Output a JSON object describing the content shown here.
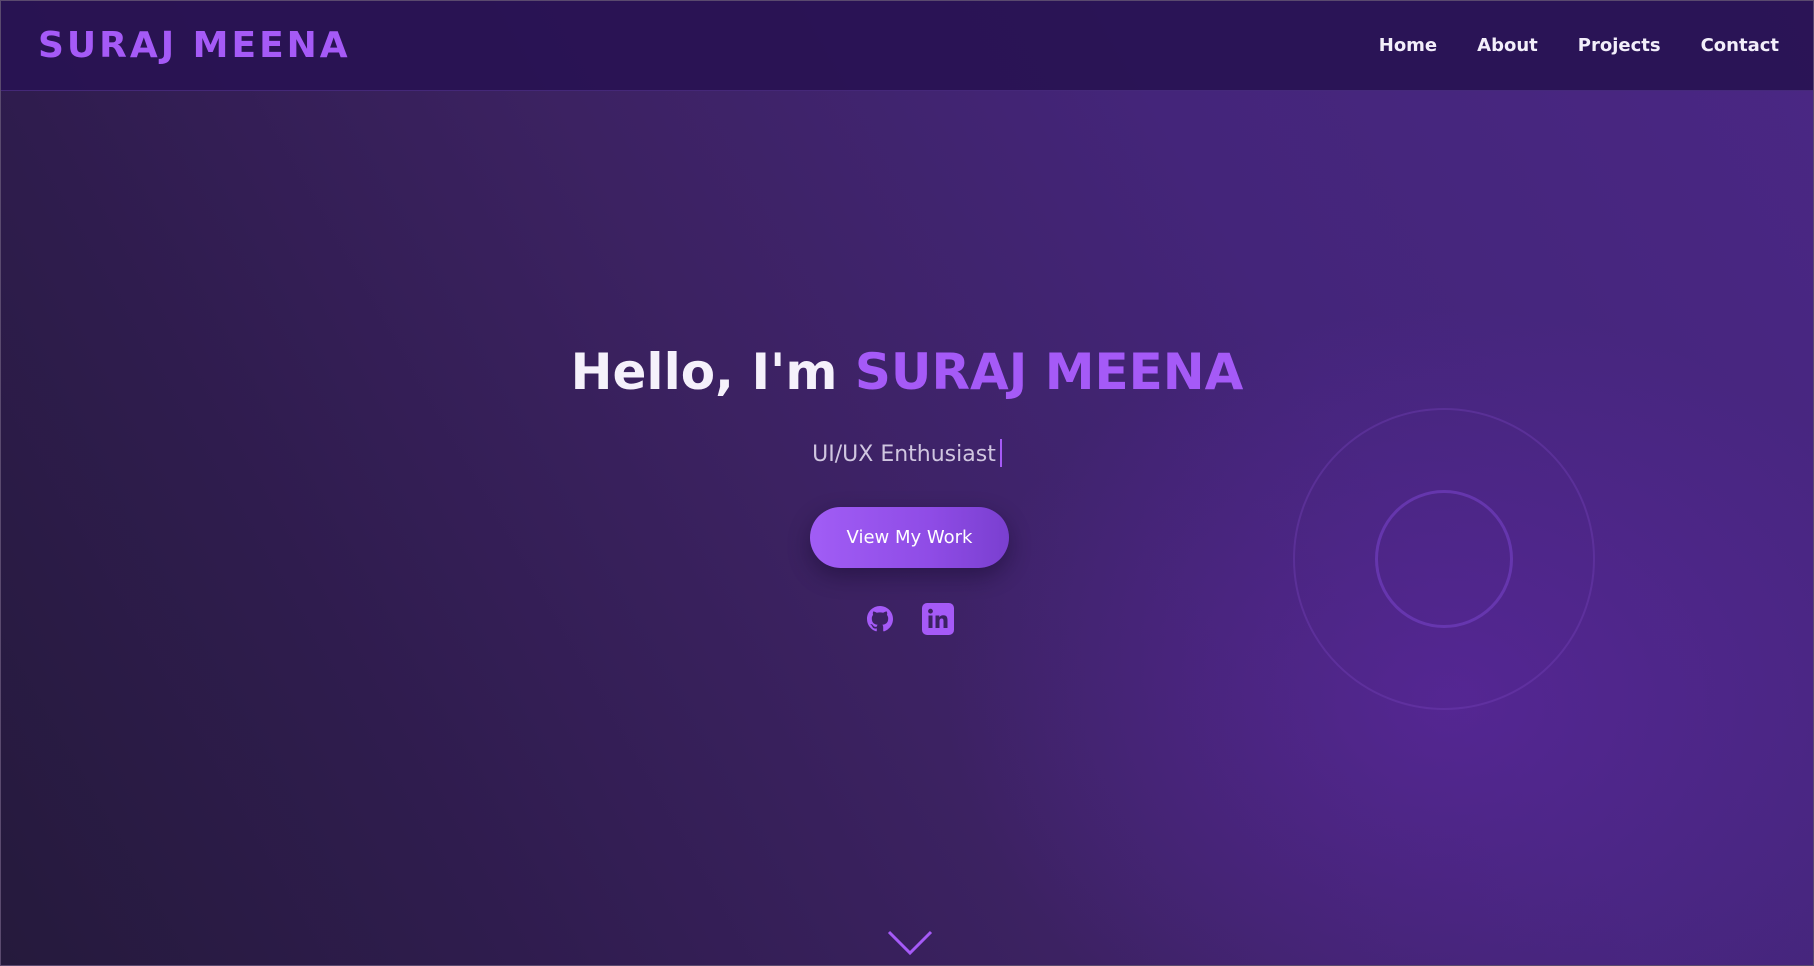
{
  "nav": {
    "logo": "SURAJ MEENA",
    "links": [
      {
        "label": "Home"
      },
      {
        "label": "About"
      },
      {
        "label": "Projects"
      },
      {
        "label": "Contact"
      }
    ]
  },
  "hero": {
    "greeting": "Hello, I'm ",
    "name": "SURAJ MEENA",
    "subtitle": "UI/UX Enthusiast",
    "cta_label": "View My Work",
    "socials": [
      {
        "icon": "github-icon"
      },
      {
        "icon": "linkedin-icon"
      }
    ],
    "scroll_icon": "chevron-down-icon"
  },
  "colors": {
    "accent": "#a55af7",
    "nav_background": "#281252",
    "text": "#f5f1fb"
  }
}
